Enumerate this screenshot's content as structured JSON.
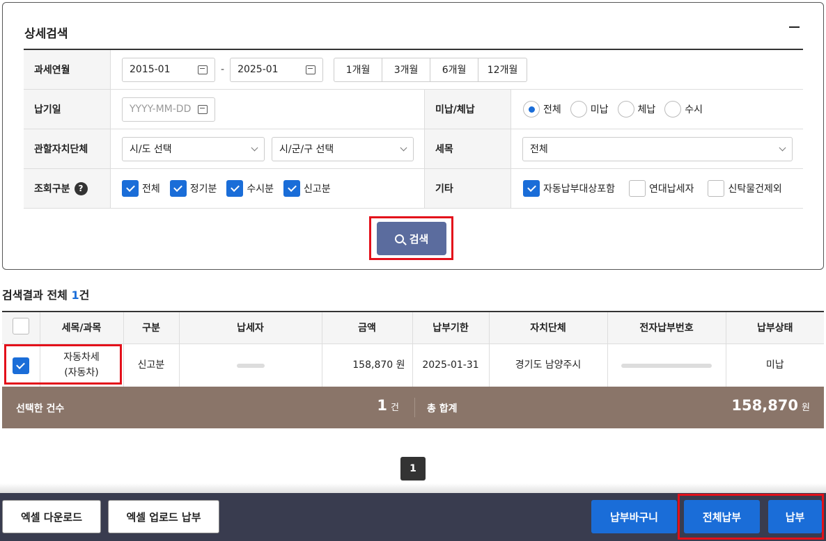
{
  "panel": {
    "title": "상세검색"
  },
  "form": {
    "tax_year_month": {
      "label": "과세연월",
      "from": "2015-01",
      "to": "2025-01",
      "separator": "-",
      "periods": [
        "1개월",
        "3개월",
        "6개월",
        "12개월"
      ]
    },
    "pay_date": {
      "label": "납기일",
      "placeholder": "YYYY-MM-DD"
    },
    "unpaid": {
      "label": "미납/체납",
      "options": [
        "전체",
        "미납",
        "체납",
        "수시"
      ],
      "selected": "전체"
    },
    "jurisdiction": {
      "label": "관할자치단체",
      "sido": "시/도 선택",
      "sigungu": "시/군/구 선택"
    },
    "tax_item": {
      "label": "세목",
      "value": "전체"
    },
    "query_type": {
      "label": "조회구분",
      "help": "?",
      "options": [
        "전체",
        "정기분",
        "수시분",
        "신고분"
      ]
    },
    "etc": {
      "label": "기타",
      "options": [
        "자동납부대상포함",
        "연대납세자",
        "신탁물건제외"
      ]
    }
  },
  "search_button": "검색",
  "result": {
    "prefix": "검색결과 전체 ",
    "count": "1",
    "suffix": "건"
  },
  "table": {
    "headers": [
      "세목/과목",
      "구분",
      "납세자",
      "금액",
      "납부기한",
      "자치단체",
      "전자납부번호",
      "납부상태"
    ],
    "rows": [
      {
        "tax": "자동차세",
        "sub": "(자동차)",
        "type": "신고분",
        "amount": "158,870 원",
        "due": "2025-01-31",
        "region": "경기도 남양주시",
        "status": "미납"
      }
    ]
  },
  "summary": {
    "selected_label": "선택한 건수",
    "selected_count": "1",
    "count_unit": "건",
    "total_label": "총 합계",
    "total": "158,870",
    "total_unit": "원"
  },
  "pagination": {
    "current": "1"
  },
  "footer": {
    "excel_download": "엑셀 다운로드",
    "excel_upload": "엑셀 업로드 납부",
    "basket": "납부바구니",
    "pay_all": "전체납부",
    "pay": "납부"
  },
  "colors": {
    "accent": "#1a6dd8",
    "search": "#5b6c9e",
    "summary_bg": "#8a7569",
    "footer_bg": "#393c4f",
    "highlight": "#e3101a"
  }
}
